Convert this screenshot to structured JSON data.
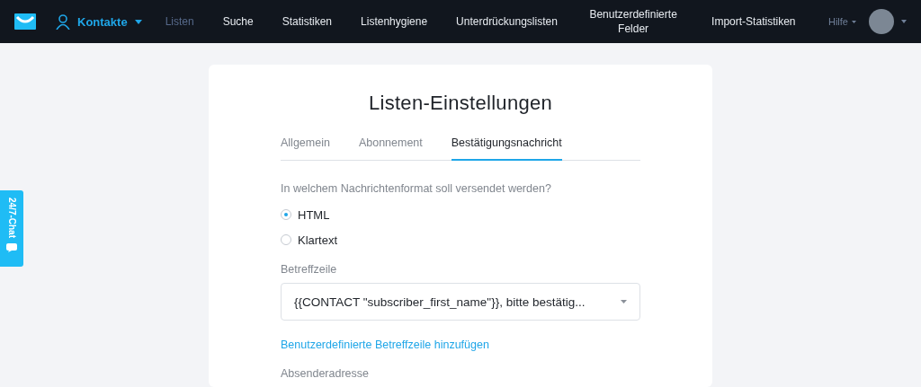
{
  "nav": {
    "menu": {
      "label": "Kontakte"
    },
    "items": [
      {
        "label": "Listen",
        "selected": true
      },
      {
        "label": "Suche",
        "selected": false
      },
      {
        "label": "Statistiken",
        "selected": false
      },
      {
        "label": "Listenhygiene",
        "selected": false
      },
      {
        "label": "Unterdrückungslisten",
        "selected": false
      },
      {
        "label": "Benutzerdefinierte Felder",
        "selected": false
      },
      {
        "label": "Import-Statistiken",
        "selected": false
      }
    ],
    "help": "Hilfe"
  },
  "chat": {
    "label": "24/7-Chat"
  },
  "card": {
    "title": "Listen-Einstellungen",
    "tabs": [
      {
        "label": "Allgemein",
        "selected": false
      },
      {
        "label": "Abonnement",
        "selected": false
      },
      {
        "label": "Bestätigungsnachricht",
        "selected": true
      }
    ],
    "format_question": "In welchem Nachrichtenformat soll versendet werden?",
    "formats": [
      {
        "label": "HTML",
        "selected": true
      },
      {
        "label": "Klartext",
        "selected": false
      }
    ],
    "subject": {
      "label": "Betreffzeile",
      "value": "{{CONTACT \"subscriber_first_name\"}}, bitte bestätig..."
    },
    "custom_subject_link": "Benutzerdefinierte Betreffzeile hinzufügen",
    "sender": {
      "label": "Absenderadresse"
    }
  }
}
